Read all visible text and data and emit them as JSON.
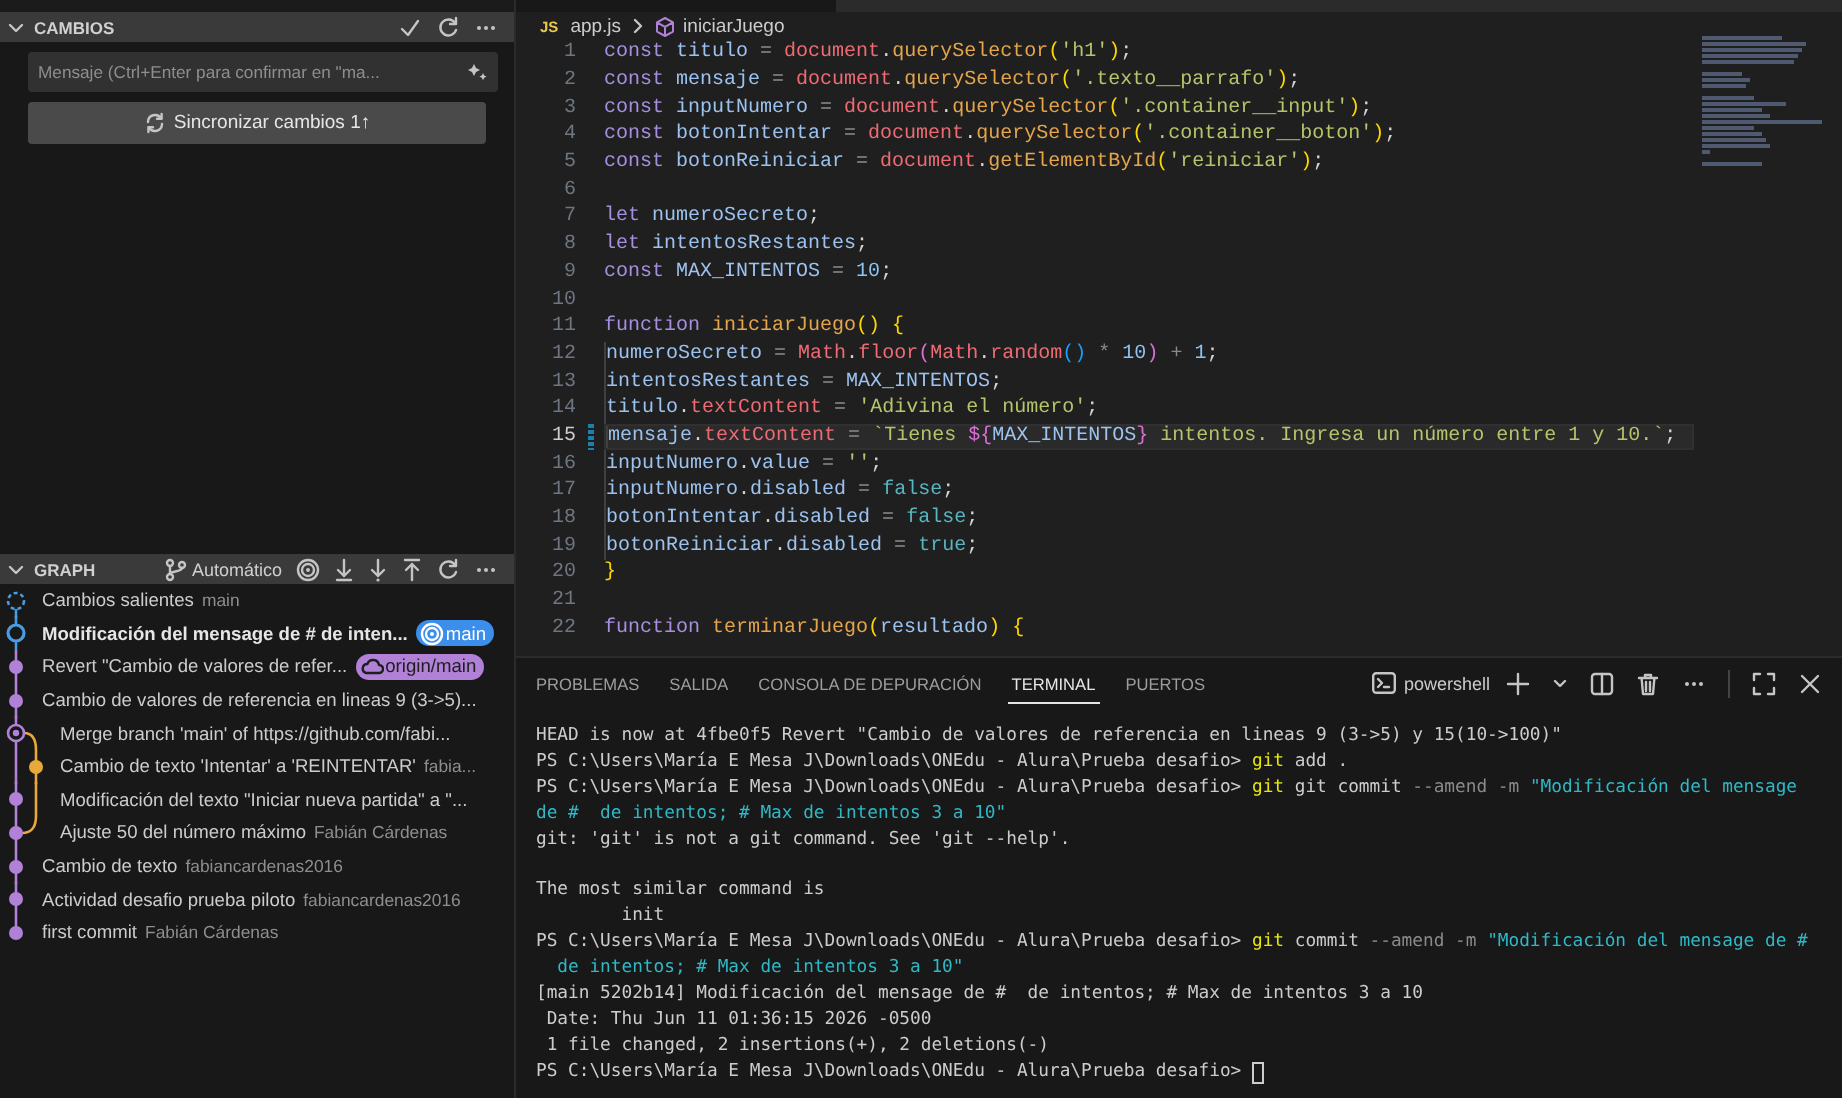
{
  "changes": {
    "title": "CAMBIOS",
    "message": {
      "placeholder": "Mensaje (Ctrl+Enter para confirmar en \"ma..."
    },
    "sync_button": "Sincronizar cambios 1↑"
  },
  "graph": {
    "title": "GRAPH",
    "mode": "Automático",
    "items": [
      {
        "kind": "outgoing",
        "message": "Cambios salientes",
        "detail": "main",
        "current": false
      },
      {
        "kind": "head",
        "message": "Modificación del mensage de #  de inten...",
        "current": true,
        "badge": {
          "kind": "local",
          "label": "main"
        }
      },
      {
        "kind": "commit",
        "message": "Revert \"Cambio de valores de refer...",
        "current": false,
        "badge": {
          "kind": "remote",
          "label": "origin/main"
        }
      },
      {
        "kind": "commit",
        "message": "Cambio de valores de referencia en lineas 9 (3->5)...",
        "current": false
      },
      {
        "kind": "merge",
        "message": "Merge branch 'main' of https://github.com/fabi...",
        "current": false
      },
      {
        "kind": "side",
        "message": "Cambio de texto 'Intentar' a 'REINTENTAR'",
        "detail": "fabia...",
        "current": false
      },
      {
        "kind": "inner",
        "message": "Modificación del texto \"Iniciar nueva partida\" a \"...",
        "current": false
      },
      {
        "kind": "join",
        "message": "Ajuste 50 del número máximo",
        "detail": "Fabián Cárdenas",
        "current": false
      },
      {
        "kind": "commit",
        "message": "Cambio de texto",
        "detail": "fabiancardenas2016",
        "current": false
      },
      {
        "kind": "commit",
        "message": "Actividad desafio prueba piloto",
        "detail": "fabiancardenas2016",
        "current": false
      },
      {
        "kind": "last",
        "message": "first commit",
        "detail": "Fabián Cárdenas",
        "current": false
      }
    ]
  },
  "breadcrumb": {
    "file_icon": "JS",
    "file": "app.js",
    "symbol": "iniciarJuego"
  },
  "code": {
    "lines": [
      {
        "number": "1",
        "current": false,
        "modified": false,
        "indented": false,
        "tokens": [
          {
            "kind": "kw",
            "text": "const "
          },
          {
            "kind": "var",
            "text": "titulo"
          },
          {
            "kind": "op",
            "text": " = "
          },
          {
            "kind": "obj",
            "text": "document"
          },
          {
            "kind": "punct",
            "text": "."
          },
          {
            "kind": "fn",
            "text": "querySelector"
          },
          {
            "kind": "br1",
            "text": "("
          },
          {
            "kind": "str",
            "text": "'h1'"
          },
          {
            "kind": "br1",
            "text": ")"
          },
          {
            "kind": "punct",
            "text": ";"
          }
        ]
      },
      {
        "number": "2",
        "current": false,
        "modified": false,
        "indented": false,
        "tokens": [
          {
            "kind": "kw",
            "text": "const "
          },
          {
            "kind": "var",
            "text": "mensaje"
          },
          {
            "kind": "op",
            "text": " = "
          },
          {
            "kind": "obj",
            "text": "document"
          },
          {
            "kind": "punct",
            "text": "."
          },
          {
            "kind": "fn",
            "text": "querySelector"
          },
          {
            "kind": "br1",
            "text": "("
          },
          {
            "kind": "str",
            "text": "'.texto__parrafo'"
          },
          {
            "kind": "br1",
            "text": ")"
          },
          {
            "kind": "punct",
            "text": ";"
          }
        ]
      },
      {
        "number": "3",
        "current": false,
        "modified": false,
        "indented": false,
        "tokens": [
          {
            "kind": "kw",
            "text": "const "
          },
          {
            "kind": "var",
            "text": "inputNumero"
          },
          {
            "kind": "op",
            "text": " = "
          },
          {
            "kind": "obj",
            "text": "document"
          },
          {
            "kind": "punct",
            "text": "."
          },
          {
            "kind": "fn",
            "text": "querySelector"
          },
          {
            "kind": "br1",
            "text": "("
          },
          {
            "kind": "str",
            "text": "'.container__input'"
          },
          {
            "kind": "br1",
            "text": ")"
          },
          {
            "kind": "punct",
            "text": ";"
          }
        ]
      },
      {
        "number": "4",
        "current": false,
        "modified": false,
        "indented": false,
        "tokens": [
          {
            "kind": "kw",
            "text": "const "
          },
          {
            "kind": "var",
            "text": "botonIntentar"
          },
          {
            "kind": "op",
            "text": " = "
          },
          {
            "kind": "obj",
            "text": "document"
          },
          {
            "kind": "punct",
            "text": "."
          },
          {
            "kind": "fn",
            "text": "querySelector"
          },
          {
            "kind": "br1",
            "text": "("
          },
          {
            "kind": "str",
            "text": "'.container__boton'"
          },
          {
            "kind": "br1",
            "text": ")"
          },
          {
            "kind": "punct",
            "text": ";"
          }
        ]
      },
      {
        "number": "5",
        "current": false,
        "modified": false,
        "indented": false,
        "tokens": [
          {
            "kind": "kw",
            "text": "const "
          },
          {
            "kind": "var",
            "text": "botonReiniciar"
          },
          {
            "kind": "op",
            "text": " = "
          },
          {
            "kind": "obj",
            "text": "document"
          },
          {
            "kind": "punct",
            "text": "."
          },
          {
            "kind": "fn",
            "text": "getElementById"
          },
          {
            "kind": "br1",
            "text": "("
          },
          {
            "kind": "str",
            "text": "'reiniciar'"
          },
          {
            "kind": "br1",
            "text": ")"
          },
          {
            "kind": "punct",
            "text": ";"
          }
        ]
      },
      {
        "number": "6",
        "current": false,
        "modified": false,
        "indented": false
      },
      {
        "number": "7",
        "current": false,
        "modified": false,
        "indented": false,
        "tokens": [
          {
            "kind": "kw",
            "text": "let "
          },
          {
            "kind": "var",
            "text": "numeroSecreto"
          },
          {
            "kind": "punct",
            "text": ";"
          }
        ]
      },
      {
        "number": "8",
        "current": false,
        "modified": false,
        "indented": false,
        "tokens": [
          {
            "kind": "kw",
            "text": "let "
          },
          {
            "kind": "var",
            "text": "intentosRestantes"
          },
          {
            "kind": "punct",
            "text": ";"
          }
        ]
      },
      {
        "number": "9",
        "current": false,
        "modified": false,
        "indented": false,
        "tokens": [
          {
            "kind": "kw",
            "text": "const "
          },
          {
            "kind": "var",
            "text": "MAX_INTENTOS"
          },
          {
            "kind": "op",
            "text": " = "
          },
          {
            "kind": "num",
            "text": "10"
          },
          {
            "kind": "punct",
            "text": ";"
          }
        ]
      },
      {
        "number": "10",
        "current": false,
        "modified": false,
        "indented": false
      },
      {
        "number": "11",
        "current": false,
        "modified": false,
        "indented": false,
        "tokens": [
          {
            "kind": "kw",
            "text": "function "
          },
          {
            "kind": "fn",
            "text": "iniciarJuego"
          },
          {
            "kind": "br1",
            "text": "() "
          },
          {
            "kind": "br1",
            "text": "{"
          }
        ]
      },
      {
        "number": "12",
        "current": false,
        "modified": false,
        "indented": true,
        "tokens": [
          {
            "kind": "var",
            "text": "numeroSecreto"
          },
          {
            "kind": "op",
            "text": " = "
          },
          {
            "kind": "obj",
            "text": "Math"
          },
          {
            "kind": "punct",
            "text": "."
          },
          {
            "kind": "obj",
            "text": "floor"
          },
          {
            "kind": "br2",
            "text": "("
          },
          {
            "kind": "obj",
            "text": "Math"
          },
          {
            "kind": "punct",
            "text": "."
          },
          {
            "kind": "obj",
            "text": "random"
          },
          {
            "kind": "br3",
            "text": "()"
          },
          {
            "kind": "op",
            "text": " * "
          },
          {
            "kind": "num",
            "text": "10"
          },
          {
            "kind": "br2",
            "text": ")"
          },
          {
            "kind": "op",
            "text": " + "
          },
          {
            "kind": "num",
            "text": "1"
          },
          {
            "kind": "punct",
            "text": ";"
          }
        ]
      },
      {
        "number": "13",
        "current": false,
        "modified": false,
        "indented": true,
        "tokens": [
          {
            "kind": "var",
            "text": "intentosRestantes"
          },
          {
            "kind": "op",
            "text": " = "
          },
          {
            "kind": "var",
            "text": "MAX_INTENTOS"
          },
          {
            "kind": "punct",
            "text": ";"
          }
        ]
      },
      {
        "number": "14",
        "current": false,
        "modified": false,
        "indented": true,
        "tokens": [
          {
            "kind": "var",
            "text": "titulo"
          },
          {
            "kind": "punct",
            "text": "."
          },
          {
            "kind": "prop",
            "text": "textContent"
          },
          {
            "kind": "op",
            "text": " = "
          },
          {
            "kind": "str",
            "text": "'Adivina el número'"
          },
          {
            "kind": "punct",
            "text": ";"
          }
        ]
      },
      {
        "number": "15",
        "current": true,
        "modified": true,
        "indented": true,
        "tokens": [
          {
            "kind": "var",
            "text": "mensaje"
          },
          {
            "kind": "punct",
            "text": "."
          },
          {
            "kind": "prop",
            "text": "textContent"
          },
          {
            "kind": "op",
            "text": " = "
          },
          {
            "kind": "str",
            "text": "`Tienes "
          },
          {
            "kind": "br2",
            "text": "${"
          },
          {
            "kind": "var",
            "text": "MAX_INTENTOS"
          },
          {
            "kind": "br2",
            "text": "}"
          },
          {
            "kind": "str",
            "text": " intentos. Ingresa un número entre 1 y 10.`"
          },
          {
            "kind": "punct",
            "text": ";"
          }
        ]
      },
      {
        "number": "16",
        "current": false,
        "modified": false,
        "indented": true,
        "tokens": [
          {
            "kind": "var",
            "text": "inputNumero"
          },
          {
            "kind": "punct",
            "text": "."
          },
          {
            "kind": "var",
            "text": "value"
          },
          {
            "kind": "op",
            "text": " = "
          },
          {
            "kind": "str",
            "text": "''"
          },
          {
            "kind": "punct",
            "text": ";"
          }
        ]
      },
      {
        "number": "17",
        "current": false,
        "modified": false,
        "indented": true,
        "tokens": [
          {
            "kind": "var",
            "text": "inputNumero"
          },
          {
            "kind": "punct",
            "text": "."
          },
          {
            "kind": "var",
            "text": "disabled"
          },
          {
            "kind": "op",
            "text": " = "
          },
          {
            "kind": "bool",
            "text": "false"
          },
          {
            "kind": "punct",
            "text": ";"
          }
        ]
      },
      {
        "number": "18",
        "current": false,
        "modified": false,
        "indented": true,
        "tokens": [
          {
            "kind": "var",
            "text": "botonIntentar"
          },
          {
            "kind": "punct",
            "text": "."
          },
          {
            "kind": "var",
            "text": "disabled"
          },
          {
            "kind": "op",
            "text": " = "
          },
          {
            "kind": "bool",
            "text": "false"
          },
          {
            "kind": "punct",
            "text": ";"
          }
        ]
      },
      {
        "number": "19",
        "current": false,
        "modified": false,
        "indented": true,
        "tokens": [
          {
            "kind": "var",
            "text": "botonReiniciar"
          },
          {
            "kind": "punct",
            "text": "."
          },
          {
            "kind": "var",
            "text": "disabled"
          },
          {
            "kind": "op",
            "text": " = "
          },
          {
            "kind": "bool",
            "text": "true"
          },
          {
            "kind": "punct",
            "text": ";"
          }
        ]
      },
      {
        "number": "20",
        "current": false,
        "modified": false,
        "indented": false,
        "tokens": [
          {
            "kind": "br1",
            "text": "}"
          }
        ]
      },
      {
        "number": "21",
        "current": false,
        "modified": false,
        "indented": false
      },
      {
        "number": "22",
        "current": false,
        "modified": false,
        "indented": false,
        "tokens": [
          {
            "kind": "kw",
            "text": "function "
          },
          {
            "kind": "fn",
            "text": "terminarJuego"
          },
          {
            "kind": "br1",
            "text": "("
          },
          {
            "kind": "var",
            "text": "resultado"
          },
          {
            "kind": "br1",
            "text": ") "
          },
          {
            "kind": "br1",
            "text": "{"
          }
        ]
      }
    ]
  },
  "panel": {
    "tabs": [
      {
        "label": "PROBLEMAS",
        "selected": false
      },
      {
        "label": "SALIDA",
        "selected": false
      },
      {
        "label": "CONSOLA DE DEPURACIÓN",
        "selected": false
      },
      {
        "label": "TERMINAL",
        "selected": true
      },
      {
        "label": "PUERTOS",
        "selected": false
      }
    ],
    "shell": "powershell",
    "terminal": [
      {
        "blank_before": false,
        "cursor": false,
        "spans": [
          {
            "kind": "plain",
            "text": "HEAD is now at 4fbe0f5 Revert \"Cambio de valores de referencia en lineas 9 (3->5) y 15(10->100)\""
          }
        ]
      },
      {
        "blank_before": false,
        "cursor": false,
        "spans": [
          {
            "kind": "plain",
            "text": "PS C:\\Users\\María E Mesa J\\Downloads\\ONEdu - Alura\\Prueba desafio> "
          },
          {
            "kind": "cmd",
            "text": "git"
          },
          {
            "kind": "plain",
            "text": " add ."
          }
        ]
      },
      {
        "blank_before": false,
        "cursor": false,
        "spans": [
          {
            "kind": "plain",
            "text": "PS C:\\Users\\María E Mesa J\\Downloads\\ONEdu - Alura\\Prueba desafio> "
          },
          {
            "kind": "cmd",
            "text": "git"
          },
          {
            "kind": "plain",
            "text": " git commit "
          },
          {
            "kind": "flag",
            "text": "--amend -m "
          },
          {
            "kind": "str",
            "text": "\"Modificación del mensage"
          }
        ]
      },
      {
        "blank_before": false,
        "cursor": false,
        "spans": [
          {
            "kind": "str",
            "text": "de #  de intentos; # Max de intentos 3 a 10\""
          }
        ]
      },
      {
        "blank_before": false,
        "cursor": false,
        "spans": [
          {
            "kind": "plain",
            "text": "git: 'git' is not a git command. See 'git --help'."
          }
        ]
      },
      {
        "blank_before": true,
        "cursor": false,
        "spans": [
          {
            "kind": "plain",
            "text": "The most similar command is"
          }
        ]
      },
      {
        "blank_before": false,
        "cursor": false,
        "spans": [
          {
            "kind": "plain",
            "text": "        init"
          }
        ]
      },
      {
        "blank_before": false,
        "cursor": false,
        "spans": [
          {
            "kind": "plain",
            "text": "PS C:\\Users\\María E Mesa J\\Downloads\\ONEdu - Alura\\Prueba desafio> "
          },
          {
            "kind": "cmd",
            "text": "git"
          },
          {
            "kind": "plain",
            "text": " commit "
          },
          {
            "kind": "flag",
            "text": "--amend -m "
          },
          {
            "kind": "str",
            "text": "\"Modificación del mensage de #"
          }
        ]
      },
      {
        "blank_before": false,
        "cursor": false,
        "spans": [
          {
            "kind": "str",
            "text": "  de intentos; # Max de intentos 3 a 10\""
          }
        ]
      },
      {
        "blank_before": false,
        "cursor": false,
        "spans": [
          {
            "kind": "plain",
            "text": "[main 5202b14] Modificación del mensage de #  de intentos; # Max de intentos 3 a 10"
          }
        ]
      },
      {
        "blank_before": false,
        "cursor": false,
        "spans": [
          {
            "kind": "plain",
            "text": " Date: Thu Jun 11 01:36:15 2026 -0500"
          }
        ]
      },
      {
        "blank_before": false,
        "cursor": false,
        "spans": [
          {
            "kind": "plain",
            "text": " 1 file changed, 2 insertions(+), 2 deletions(-)"
          }
        ]
      },
      {
        "blank_before": false,
        "cursor": true,
        "spans": [
          {
            "kind": "plain",
            "text": "PS C:\\Users\\María E Mesa J\\Downloads\\ONEdu - Alura\\Prueba desafio> "
          }
        ]
      }
    ]
  }
}
